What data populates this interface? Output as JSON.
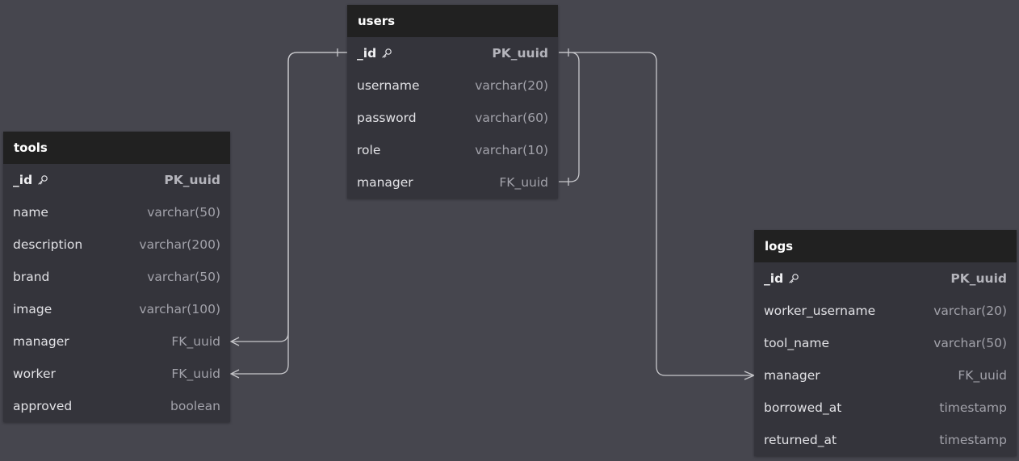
{
  "tables": {
    "users": {
      "name": "users",
      "rows": [
        {
          "name": "_id",
          "type": "PK_uuid",
          "pk": true,
          "key_icon": "key-icon"
        },
        {
          "name": "username",
          "type": "varchar(20)"
        },
        {
          "name": "password",
          "type": "varchar(60)"
        },
        {
          "name": "role",
          "type": "varchar(10)"
        },
        {
          "name": "manager",
          "type": "FK_uuid"
        }
      ]
    },
    "tools": {
      "name": "tools",
      "rows": [
        {
          "name": "_id",
          "type": "PK_uuid",
          "pk": true,
          "key_icon": "key-icon"
        },
        {
          "name": "name",
          "type": "varchar(50)"
        },
        {
          "name": "description",
          "type": "varchar(200)"
        },
        {
          "name": "brand",
          "type": "varchar(50)"
        },
        {
          "name": "image",
          "type": "varchar(100)"
        },
        {
          "name": "manager",
          "type": "FK_uuid"
        },
        {
          "name": "worker",
          "type": "FK_uuid"
        },
        {
          "name": "approved",
          "type": "boolean"
        }
      ]
    },
    "logs": {
      "name": "logs",
      "rows": [
        {
          "name": "_id",
          "type": "PK_uuid",
          "pk": true,
          "key_icon": "key-icon"
        },
        {
          "name": "worker_username",
          "type": "varchar(20)"
        },
        {
          "name": "tool_name",
          "type": "varchar(50)"
        },
        {
          "name": "manager",
          "type": "FK_uuid"
        },
        {
          "name": "borrowed_at",
          "type": "timestamp"
        },
        {
          "name": "returned_at",
          "type": "timestamp"
        }
      ]
    }
  },
  "relationships": [
    {
      "from": "tools.manager",
      "to": "users._id",
      "from_end": "many",
      "to_end": "one"
    },
    {
      "from": "tools.worker",
      "to": "users._id",
      "from_end": "many",
      "to_end": "one"
    },
    {
      "from": "users.manager",
      "to": "users._id",
      "from_end": "one",
      "to_end": "one"
    },
    {
      "from": "logs.manager",
      "to": "users._id",
      "from_end": "many",
      "to_end": "one"
    }
  ],
  "colors": {
    "background": "#46464e",
    "table_body": "#34343b",
    "table_header": "#212121",
    "connector": "#c8c8cc"
  }
}
